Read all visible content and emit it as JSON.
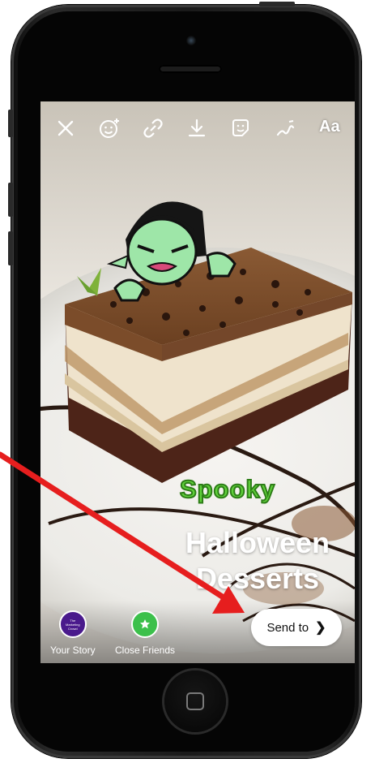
{
  "toolbar": {
    "close_icon": "close-icon",
    "stickers_icon": "face-sparkle-icon",
    "link_icon": "link-icon",
    "download_icon": "download-icon",
    "sticker_icon": "sticker-icon",
    "draw_icon": "scribble-icon",
    "text_label": "Aa"
  },
  "story": {
    "sticker_text": "Spooky",
    "caption_line1": "Halloween",
    "caption_line2": "Desserts"
  },
  "share": {
    "your_story_label": "Your Story",
    "your_story_avatar_text": "The Marketing Crowd",
    "close_friends_label": "Close Friends",
    "send_label": "Send to"
  },
  "colors": {
    "annotation_arrow": "#e61e1e",
    "close_friends_green": "#3cc04b",
    "your_story_purple": "#4a1a8c"
  }
}
